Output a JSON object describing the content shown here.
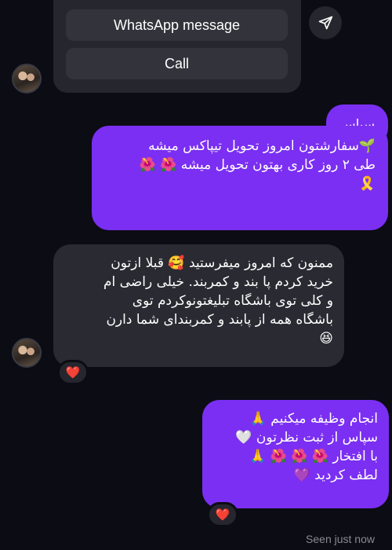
{
  "action_card": {
    "whatsapp_label": "WhatsApp message",
    "call_label": "Call"
  },
  "share_icon": "send-paper-plane-icon",
  "messages": [
    {
      "direction": "outgoing",
      "text": "سپاس"
    },
    {
      "direction": "outgoing",
      "lines": [
        "🌱سفارشتون امروز تحویل تیپاکس میشه",
        "طی ۲ روز کاری بهتون تحویل میشه 🌺 🌺",
        "🎗️"
      ]
    },
    {
      "direction": "incoming",
      "lines": [
        "ممنون که امروز میفرستید 🥰 قبلا ازتون",
        "خرید کردم پا بند و کمربند. خیلی راضی ام",
        "و کلی توی باشگاه تبلیغتونوکردم توی",
        "باشگاه همه از پابند و کمربندای شما دارن",
        "😆"
      ],
      "reaction": "❤️"
    },
    {
      "direction": "outgoing",
      "lines": [
        "انجام وظیفه میکنیم 🙏",
        "سپاس از ثبت نظرتون 🤍",
        "با افتخار 🌺 🌺 🌺 🙏",
        "لطف کردید 💜"
      ],
      "reaction": "❤️"
    }
  ],
  "status": {
    "seen": "Seen just now"
  },
  "colors": {
    "background": "#0c0c14",
    "outgoing": "#7b2ff2",
    "incoming": "#2a2a32",
    "card": "#26262e"
  }
}
